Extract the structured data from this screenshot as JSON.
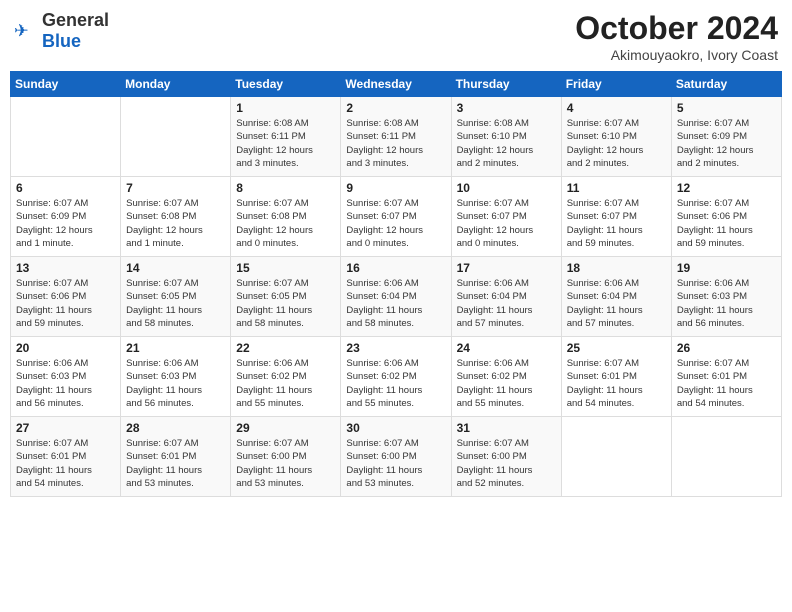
{
  "logo": {
    "general": "General",
    "blue": "Blue"
  },
  "title": "October 2024",
  "subtitle": "Akimouyaokro, Ivory Coast",
  "days_of_week": [
    "Sunday",
    "Monday",
    "Tuesday",
    "Wednesday",
    "Thursday",
    "Friday",
    "Saturday"
  ],
  "weeks": [
    [
      {
        "day": "",
        "info": ""
      },
      {
        "day": "",
        "info": ""
      },
      {
        "day": "1",
        "info": "Sunrise: 6:08 AM\nSunset: 6:11 PM\nDaylight: 12 hours\nand 3 minutes."
      },
      {
        "day": "2",
        "info": "Sunrise: 6:08 AM\nSunset: 6:11 PM\nDaylight: 12 hours\nand 3 minutes."
      },
      {
        "day": "3",
        "info": "Sunrise: 6:08 AM\nSunset: 6:10 PM\nDaylight: 12 hours\nand 2 minutes."
      },
      {
        "day": "4",
        "info": "Sunrise: 6:07 AM\nSunset: 6:10 PM\nDaylight: 12 hours\nand 2 minutes."
      },
      {
        "day": "5",
        "info": "Sunrise: 6:07 AM\nSunset: 6:09 PM\nDaylight: 12 hours\nand 2 minutes."
      }
    ],
    [
      {
        "day": "6",
        "info": "Sunrise: 6:07 AM\nSunset: 6:09 PM\nDaylight: 12 hours\nand 1 minute."
      },
      {
        "day": "7",
        "info": "Sunrise: 6:07 AM\nSunset: 6:08 PM\nDaylight: 12 hours\nand 1 minute."
      },
      {
        "day": "8",
        "info": "Sunrise: 6:07 AM\nSunset: 6:08 PM\nDaylight: 12 hours\nand 0 minutes."
      },
      {
        "day": "9",
        "info": "Sunrise: 6:07 AM\nSunset: 6:07 PM\nDaylight: 12 hours\nand 0 minutes."
      },
      {
        "day": "10",
        "info": "Sunrise: 6:07 AM\nSunset: 6:07 PM\nDaylight: 12 hours\nand 0 minutes."
      },
      {
        "day": "11",
        "info": "Sunrise: 6:07 AM\nSunset: 6:07 PM\nDaylight: 11 hours\nand 59 minutes."
      },
      {
        "day": "12",
        "info": "Sunrise: 6:07 AM\nSunset: 6:06 PM\nDaylight: 11 hours\nand 59 minutes."
      }
    ],
    [
      {
        "day": "13",
        "info": "Sunrise: 6:07 AM\nSunset: 6:06 PM\nDaylight: 11 hours\nand 59 minutes."
      },
      {
        "day": "14",
        "info": "Sunrise: 6:07 AM\nSunset: 6:05 PM\nDaylight: 11 hours\nand 58 minutes."
      },
      {
        "day": "15",
        "info": "Sunrise: 6:07 AM\nSunset: 6:05 PM\nDaylight: 11 hours\nand 58 minutes."
      },
      {
        "day": "16",
        "info": "Sunrise: 6:06 AM\nSunset: 6:04 PM\nDaylight: 11 hours\nand 58 minutes."
      },
      {
        "day": "17",
        "info": "Sunrise: 6:06 AM\nSunset: 6:04 PM\nDaylight: 11 hours\nand 57 minutes."
      },
      {
        "day": "18",
        "info": "Sunrise: 6:06 AM\nSunset: 6:04 PM\nDaylight: 11 hours\nand 57 minutes."
      },
      {
        "day": "19",
        "info": "Sunrise: 6:06 AM\nSunset: 6:03 PM\nDaylight: 11 hours\nand 56 minutes."
      }
    ],
    [
      {
        "day": "20",
        "info": "Sunrise: 6:06 AM\nSunset: 6:03 PM\nDaylight: 11 hours\nand 56 minutes."
      },
      {
        "day": "21",
        "info": "Sunrise: 6:06 AM\nSunset: 6:03 PM\nDaylight: 11 hours\nand 56 minutes."
      },
      {
        "day": "22",
        "info": "Sunrise: 6:06 AM\nSunset: 6:02 PM\nDaylight: 11 hours\nand 55 minutes."
      },
      {
        "day": "23",
        "info": "Sunrise: 6:06 AM\nSunset: 6:02 PM\nDaylight: 11 hours\nand 55 minutes."
      },
      {
        "day": "24",
        "info": "Sunrise: 6:06 AM\nSunset: 6:02 PM\nDaylight: 11 hours\nand 55 minutes."
      },
      {
        "day": "25",
        "info": "Sunrise: 6:07 AM\nSunset: 6:01 PM\nDaylight: 11 hours\nand 54 minutes."
      },
      {
        "day": "26",
        "info": "Sunrise: 6:07 AM\nSunset: 6:01 PM\nDaylight: 11 hours\nand 54 minutes."
      }
    ],
    [
      {
        "day": "27",
        "info": "Sunrise: 6:07 AM\nSunset: 6:01 PM\nDaylight: 11 hours\nand 54 minutes."
      },
      {
        "day": "28",
        "info": "Sunrise: 6:07 AM\nSunset: 6:01 PM\nDaylight: 11 hours\nand 53 minutes."
      },
      {
        "day": "29",
        "info": "Sunrise: 6:07 AM\nSunset: 6:00 PM\nDaylight: 11 hours\nand 53 minutes."
      },
      {
        "day": "30",
        "info": "Sunrise: 6:07 AM\nSunset: 6:00 PM\nDaylight: 11 hours\nand 53 minutes."
      },
      {
        "day": "31",
        "info": "Sunrise: 6:07 AM\nSunset: 6:00 PM\nDaylight: 11 hours\nand 52 minutes."
      },
      {
        "day": "",
        "info": ""
      },
      {
        "day": "",
        "info": ""
      }
    ]
  ]
}
